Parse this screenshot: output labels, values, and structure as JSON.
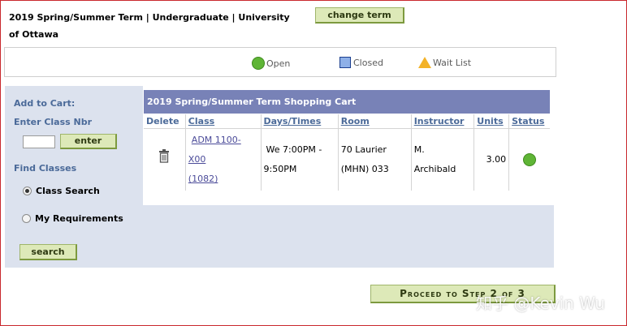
{
  "header": {
    "term_line1": "2019 Spring/Summer Term | Undergraduate | University",
    "term_line2": "of Ottawa",
    "change_term_label": "change term"
  },
  "legend": {
    "open": "Open",
    "closed": "Closed",
    "waitlist": "Wait List"
  },
  "sidebar": {
    "add_to_cart": "Add to Cart:",
    "enter_class_nbr": "Enter Class Nbr",
    "class_nbr_value": "",
    "enter_label": "enter",
    "find_classes": "Find Classes",
    "class_search": "Class Search",
    "my_requirements": "My Requirements",
    "search_label": "search",
    "selected_option": "Class Search"
  },
  "cart": {
    "title": "2019 Spring/Summer Term Shopping Cart",
    "columns": [
      "Delete",
      "Class",
      "Days/Times",
      "Room",
      "Instructor",
      "Units",
      "Status"
    ],
    "rows": [
      {
        "class_line1": "ADM 1100-",
        "class_line2": "X00",
        "class_line3": "(1082)",
        "days_line1": "We 7:00PM -",
        "days_line2": "9:50PM",
        "room_line1": "70 Laurier",
        "room_line2": "(MHN) 033",
        "instructor_line1": "M.",
        "instructor_line2": "Archibald",
        "units": "3.00",
        "status": "open",
        "status_color": "#5fb536"
      }
    ]
  },
  "footer": {
    "proceed_label": "Proceed to Step 2 of 3",
    "watermark": "知乎 @Kevin Wu"
  },
  "colors": {
    "accent_header": "#7882b7",
    "panel_bg": "#dce2ee",
    "button_bg": "#dde9b8",
    "label_blue": "#4b6a99"
  }
}
